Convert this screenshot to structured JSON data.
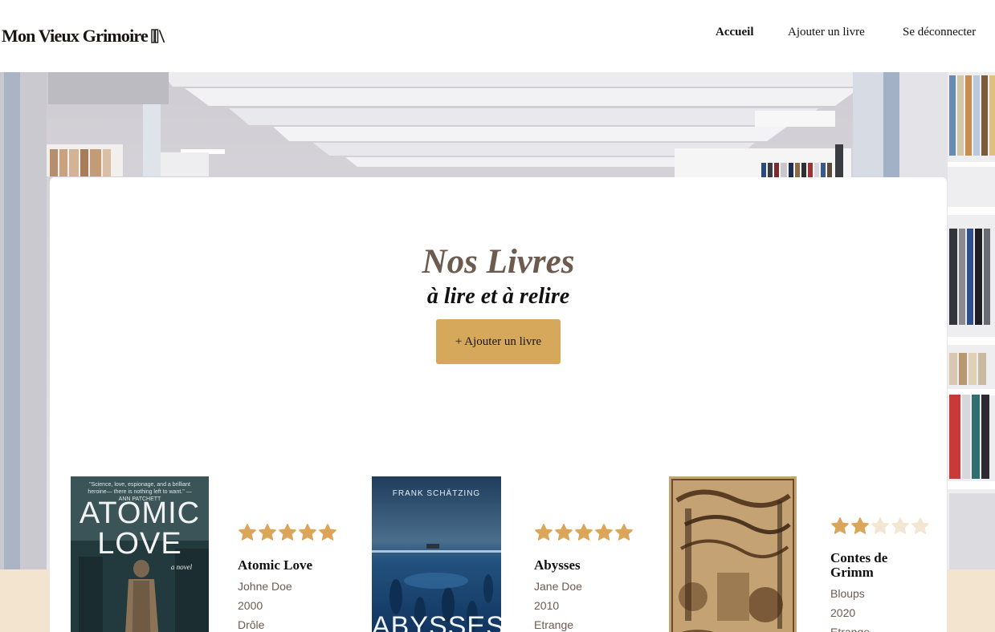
{
  "header": {
    "logo_text": "Mon Vieux Grimoire",
    "nav": {
      "home": "Accueil",
      "add_book": "Ajouter un livre",
      "logout": "Se déconnecter"
    }
  },
  "main": {
    "title": "Nos Livres",
    "subtitle": "à lire et à relire",
    "add_button": "+ Ajouter un livre"
  },
  "books": [
    {
      "title": "Atomic Love",
      "author": "Johne Doe",
      "year": "2000",
      "genre": "Drôle",
      "rating": 5,
      "cover_title_line1": "ATOMIC",
      "cover_title_line2": "LOVE",
      "cover_quote": "\"Science, love, espionage, and a brilliant heroine— there is nothing left to want.\" —ANN PATCHETT",
      "cover_subtitle": "a novel"
    },
    {
      "title": "Abysses",
      "author": "Jane Doe",
      "year": "2010",
      "genre": "Etrange",
      "rating": 5,
      "cover_author": "FRANK SCHÄTZING",
      "cover_title": "ABYSSES"
    },
    {
      "title": "Contes de Grimm",
      "author": "Bloups",
      "year": "2020",
      "genre": "Etrange",
      "rating": 2
    }
  ],
  "colors": {
    "accent": "#d6a85c",
    "star_filled": "#dba65a",
    "star_empty": "#f3e6d3",
    "title_brown": "#6d5b50",
    "floor_beige": "#f3e4cf"
  }
}
